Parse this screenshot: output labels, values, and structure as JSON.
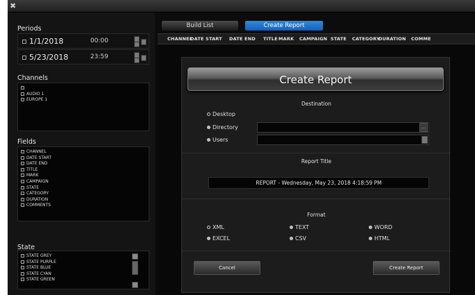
{
  "app": {
    "icon": "app-logo-icon"
  },
  "periods": {
    "label": "Periods",
    "start": {
      "date": "1/1/2018",
      "time": "00:00"
    },
    "end": {
      "date": "5/23/2018",
      "time": "23:59"
    }
  },
  "channels": {
    "label": "Channels",
    "items": [
      "",
      "AUDIO 1",
      "EUROPE 1"
    ]
  },
  "fields": {
    "label": "Fields",
    "items": [
      "CHANNEL",
      "DATE START",
      "DATE END",
      "TITLE",
      "MARK",
      "CAMPAIGN",
      "STATE",
      "CATEGORY",
      "DURATION",
      "COMMENTS"
    ]
  },
  "state": {
    "label": "State",
    "items": [
      "STATE GREY",
      "STATE PURPLE",
      "STATE BLUE",
      "STATE CYAN",
      "STATE GREEN"
    ]
  },
  "tabs": {
    "build_list": "Build List",
    "create_report": "Create Report"
  },
  "columns": [
    "CHANNEL",
    "DATE START",
    "DATE END",
    "TITLE",
    "MARK",
    "CAMPAIGN",
    "STATE",
    "CATEGORY",
    "DURATION",
    "COMME"
  ],
  "dialog": {
    "title": "Create Report",
    "destination_label": "Destination",
    "destinations": [
      "Desktop",
      "Directory",
      "Users"
    ],
    "browse_label": "...",
    "report_title_label": "Report Title",
    "report_title_value": "REPORT - Wednesday, May 23, 2018 4:18:59 PM",
    "format_label": "Format",
    "formats": [
      "XML",
      "TEXT",
      "WORD",
      "EXCEL",
      "CSV",
      "HTML"
    ],
    "cancel": "Cancel",
    "create": "Create Report"
  },
  "colors": {
    "accent_tab": "#1f78d1",
    "background": "#0c0c0c"
  }
}
